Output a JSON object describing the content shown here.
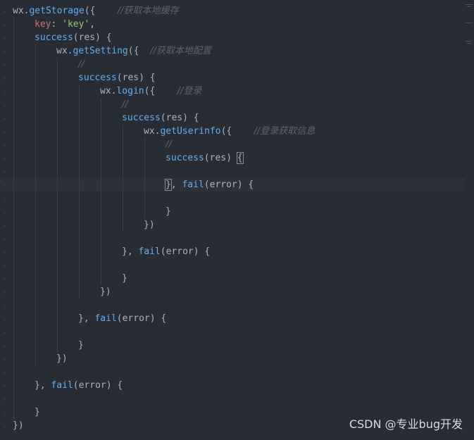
{
  "editor": {
    "lines": [
      {
        "indent": 0,
        "tokens": [
          {
            "t": "wx.",
            "c": "plain"
          },
          {
            "t": "getStorage",
            "c": "func"
          },
          {
            "t": "({    ",
            "c": "plain"
          },
          {
            "t": "//获取本地缓存",
            "c": "comment"
          }
        ]
      },
      {
        "indent": 1,
        "tokens": [
          {
            "t": "key",
            "c": "key"
          },
          {
            "t": ": ",
            "c": "plain"
          },
          {
            "t": "'key'",
            "c": "str"
          },
          {
            "t": ",",
            "c": "plain"
          }
        ]
      },
      {
        "indent": 1,
        "tokens": [
          {
            "t": "success",
            "c": "func"
          },
          {
            "t": "(res) {",
            "c": "plain"
          }
        ]
      },
      {
        "indent": 2,
        "tokens": [
          {
            "t": "wx.",
            "c": "plain"
          },
          {
            "t": "getSetting",
            "c": "func"
          },
          {
            "t": "({  ",
            "c": "plain"
          },
          {
            "t": "//获取本地配置",
            "c": "comment"
          }
        ]
      },
      {
        "indent": 3,
        "tokens": [
          {
            "t": "//",
            "c": "comment"
          }
        ]
      },
      {
        "indent": 3,
        "tokens": [
          {
            "t": "success",
            "c": "func"
          },
          {
            "t": "(res) {",
            "c": "plain"
          }
        ]
      },
      {
        "indent": 4,
        "tokens": [
          {
            "t": "wx.",
            "c": "plain"
          },
          {
            "t": "login",
            "c": "func"
          },
          {
            "t": "({    ",
            "c": "plain"
          },
          {
            "t": "//登录",
            "c": "comment"
          }
        ]
      },
      {
        "indent": 5,
        "tokens": [
          {
            "t": "//",
            "c": "comment"
          }
        ]
      },
      {
        "indent": 5,
        "tokens": [
          {
            "t": "success",
            "c": "func"
          },
          {
            "t": "(res) {",
            "c": "plain"
          }
        ]
      },
      {
        "indent": 6,
        "tokens": [
          {
            "t": "wx.",
            "c": "plain"
          },
          {
            "t": "getUserinfo",
            "c": "func"
          },
          {
            "t": "({    ",
            "c": "plain"
          },
          {
            "t": "//登录获取信息",
            "c": "comment"
          }
        ]
      },
      {
        "indent": 7,
        "tokens": [
          {
            "t": "//",
            "c": "comment"
          }
        ]
      },
      {
        "indent": 7,
        "tokens": [
          {
            "t": "success",
            "c": "func"
          },
          {
            "t": "(res) ",
            "c": "plain"
          },
          {
            "t": "{",
            "c": "bracket-hl"
          }
        ]
      },
      {
        "indent": 7,
        "tokens": []
      },
      {
        "indent": 7,
        "current": true,
        "tokens": [
          {
            "t": "}",
            "c": "bracket-hl"
          },
          {
            "t": ", ",
            "c": "plain"
          },
          {
            "t": "fail",
            "c": "func"
          },
          {
            "t": "(error) {",
            "c": "plain"
          }
        ]
      },
      {
        "indent": 7,
        "tokens": []
      },
      {
        "indent": 7,
        "tokens": [
          {
            "t": "}",
            "c": "plain"
          }
        ]
      },
      {
        "indent": 6,
        "tokens": [
          {
            "t": "})",
            "c": "plain"
          }
        ]
      },
      {
        "indent": 5,
        "tokens": []
      },
      {
        "indent": 5,
        "tokens": [
          {
            "t": "}, ",
            "c": "plain"
          },
          {
            "t": "fail",
            "c": "func"
          },
          {
            "t": "(error) {",
            "c": "plain"
          }
        ]
      },
      {
        "indent": 5,
        "tokens": []
      },
      {
        "indent": 5,
        "tokens": [
          {
            "t": "}",
            "c": "plain"
          }
        ]
      },
      {
        "indent": 4,
        "tokens": [
          {
            "t": "})",
            "c": "plain"
          }
        ]
      },
      {
        "indent": 3,
        "tokens": []
      },
      {
        "indent": 3,
        "tokens": [
          {
            "t": "}, ",
            "c": "plain"
          },
          {
            "t": "fail",
            "c": "func"
          },
          {
            "t": "(error) {",
            "c": "plain"
          }
        ]
      },
      {
        "indent": 3,
        "tokens": []
      },
      {
        "indent": 3,
        "tokens": [
          {
            "t": "}",
            "c": "plain"
          }
        ]
      },
      {
        "indent": 2,
        "tokens": [
          {
            "t": "})",
            "c": "plain"
          }
        ]
      },
      {
        "indent": 1,
        "tokens": []
      },
      {
        "indent": 1,
        "tokens": [
          {
            "t": "}, ",
            "c": "plain"
          },
          {
            "t": "fail",
            "c": "func"
          },
          {
            "t": "(error) {",
            "c": "plain"
          }
        ]
      },
      {
        "indent": 1,
        "tokens": []
      },
      {
        "indent": 1,
        "tokens": [
          {
            "t": "}",
            "c": "plain"
          }
        ]
      },
      {
        "indent": 0,
        "tokens": [
          {
            "t": "})",
            "c": "plain"
          }
        ]
      }
    ]
  },
  "watermark": {
    "text": "CSDN @专业bug开发"
  },
  "colors": {
    "background": "#282c34",
    "function": "#61afef",
    "key": "#e06c75",
    "string": "#98c379",
    "comment": "#5c6370",
    "plain": "#abb2bf"
  }
}
